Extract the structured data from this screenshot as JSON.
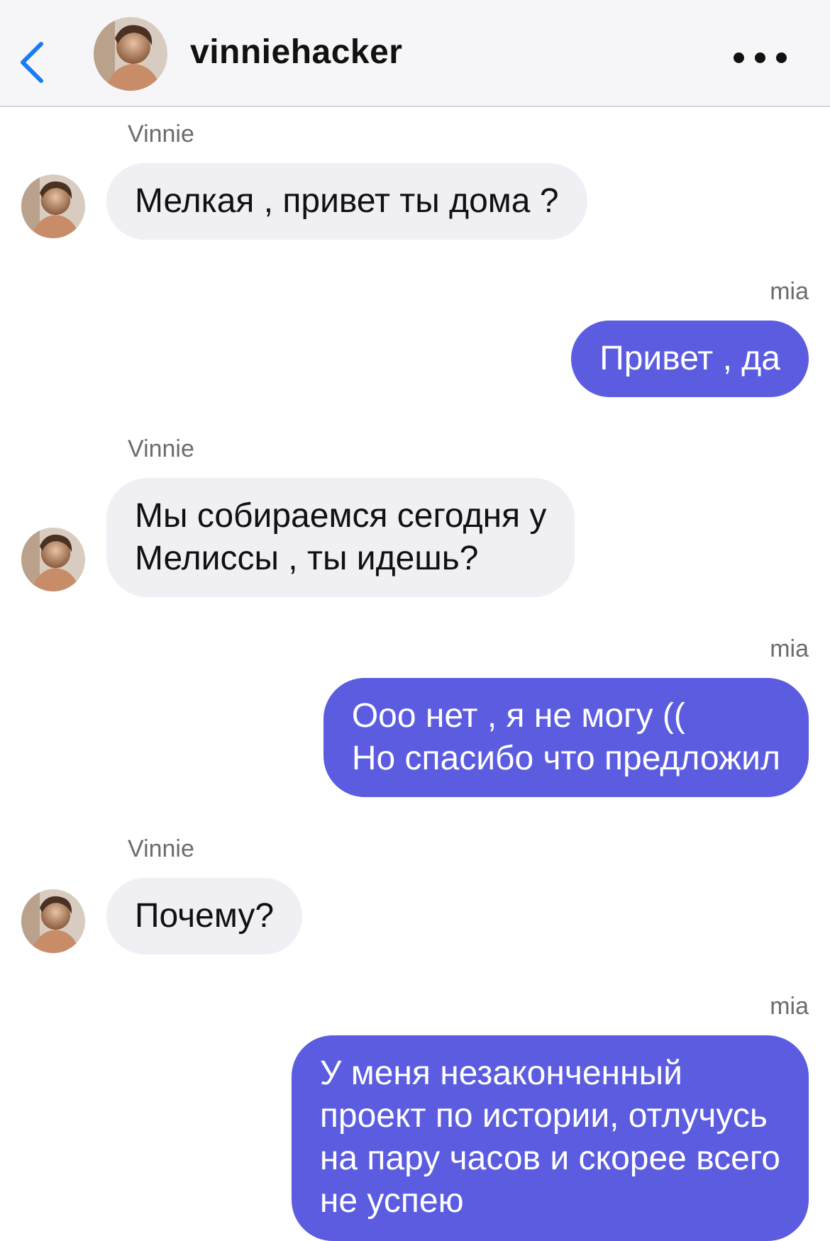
{
  "header": {
    "title": "vinniehacker",
    "back_icon": "chevron-left-icon",
    "more_icon": "more-horizontal-icon",
    "accent": "#1a7cf0"
  },
  "colors": {
    "outgoing_bubble": "#5b5ce0",
    "incoming_bubble": "#efeff4",
    "sender_label": "#6b6b70"
  },
  "messages": [
    {
      "sender": "Vinnie",
      "direction": "incoming",
      "text": "Мелкая , привет ты дома ?"
    },
    {
      "sender": "mia",
      "direction": "outgoing",
      "text": "Привет , да"
    },
    {
      "sender": "Vinnie",
      "direction": "incoming",
      "text": "Мы собираемся сегодня у\nМелиссы , ты идешь?"
    },
    {
      "sender": "mia",
      "direction": "outgoing",
      "text": "Ооо нет , я не могу ((\nНо спасибо что предложил"
    },
    {
      "sender": "Vinnie",
      "direction": "incoming",
      "text": "Почему?"
    },
    {
      "sender": "mia",
      "direction": "outgoing",
      "text": "У меня незаконченный\nпроект по истории, отлучусь\nна пару часов и скорее всего\nне успею"
    }
  ]
}
